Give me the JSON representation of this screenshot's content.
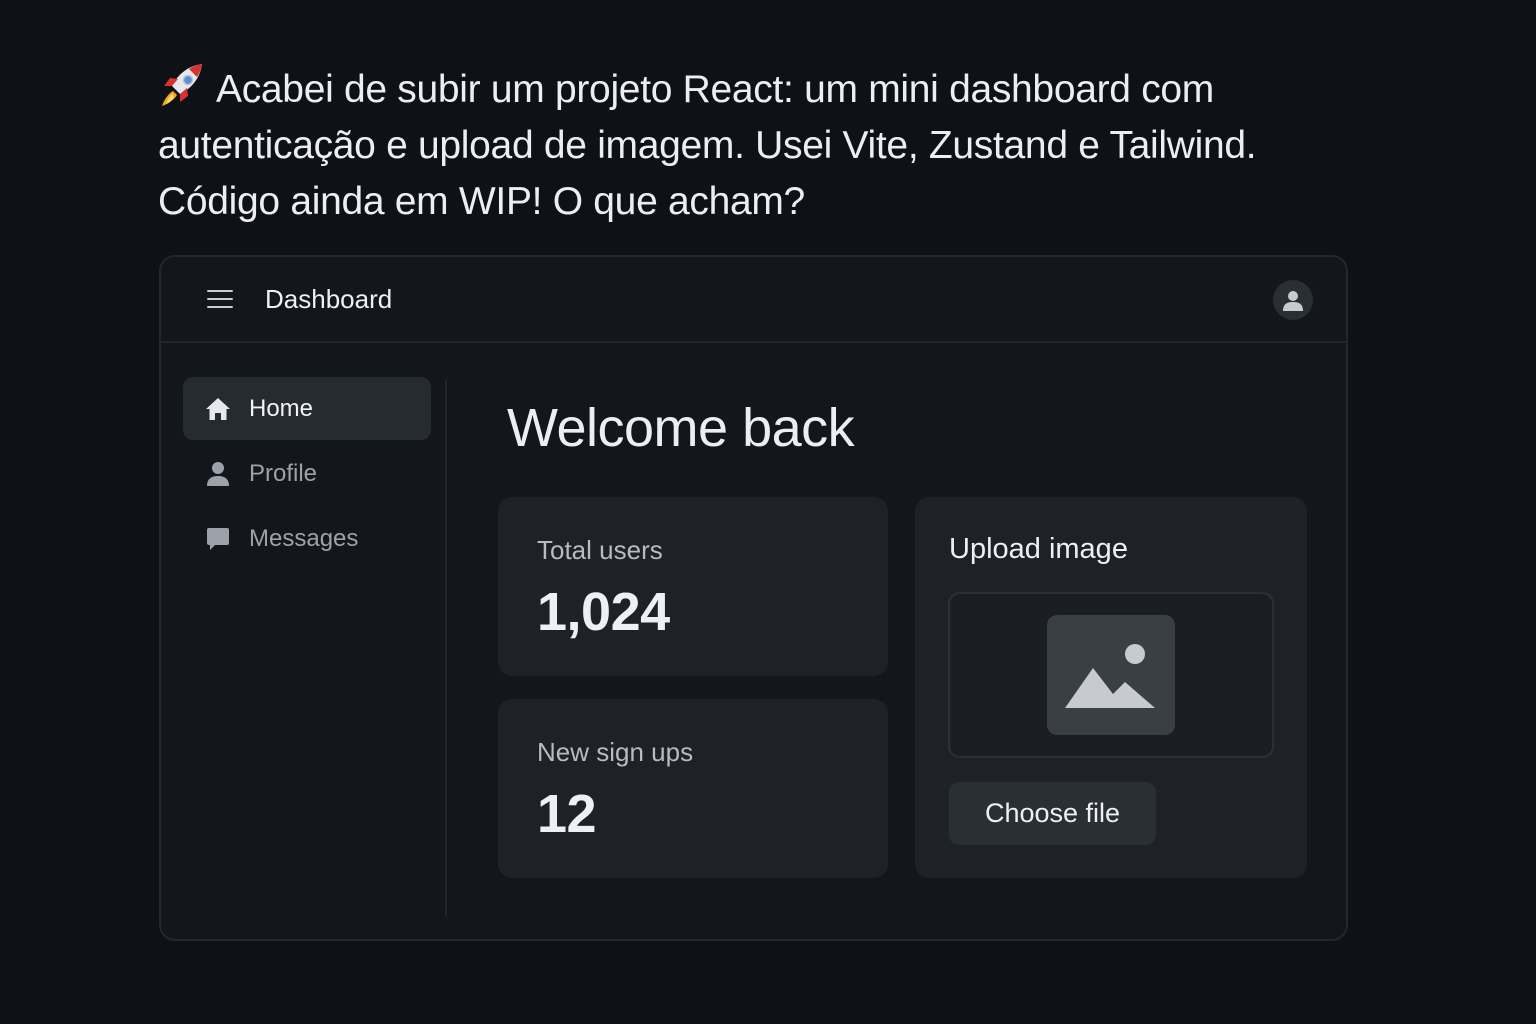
{
  "post": {
    "line1": "Acabei de subir um projeto React: um mini dashboard com",
    "line2": "autenticação e upload de imagem. Usei Vite, Zustand e Tailwind.",
    "line3": "Código ainda em WIP! O que acham?"
  },
  "header": {
    "title": "Dashboard"
  },
  "sidebar": {
    "items": [
      {
        "label": "Home",
        "icon": "home-icon",
        "active": true
      },
      {
        "label": "Profile",
        "icon": "user-icon",
        "active": false
      },
      {
        "label": "Messages",
        "icon": "message-icon",
        "active": false
      }
    ]
  },
  "main": {
    "heading": "Welcome back",
    "stats": [
      {
        "label": "Total users",
        "value": "1,024"
      },
      {
        "label": "New sign ups",
        "value": "12"
      }
    ],
    "upload": {
      "title": "Upload image",
      "button": "Choose file"
    }
  },
  "colors": {
    "background": "#0e1116",
    "card": "#1e2127",
    "active_nav": "#262a31"
  }
}
